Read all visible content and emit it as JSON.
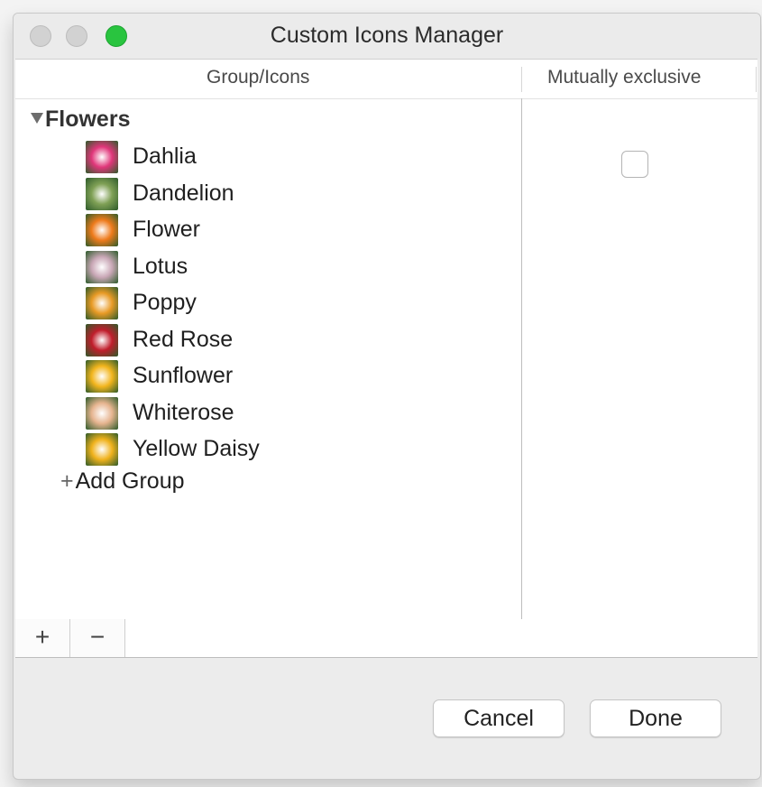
{
  "window": {
    "title": "Custom Icons Manager"
  },
  "table": {
    "columns": {
      "group_icons": "Group/Icons",
      "mutually_exclusive": "Mutually exclusive"
    },
    "group": {
      "name": "Flowers",
      "mutually_exclusive": false,
      "items": [
        {
          "label": "Dahlia",
          "icon": "dahlia-icon",
          "color": "#e0367a"
        },
        {
          "label": "Dandelion",
          "icon": "dandelion-icon",
          "color": "#7fa055"
        },
        {
          "label": "Flower",
          "icon": "flower-icon",
          "color": "#ee7a1b"
        },
        {
          "label": "Lotus",
          "icon": "lotus-icon",
          "color": "#c9a7b6"
        },
        {
          "label": "Poppy",
          "icon": "poppy-icon",
          "color": "#e89a25"
        },
        {
          "label": "Red Rose",
          "icon": "red-rose-icon",
          "color": "#c01d2b"
        },
        {
          "label": "Sunflower",
          "icon": "sunflower-icon",
          "color": "#f2b51d"
        },
        {
          "label": "Whiterose",
          "icon": "whiterose-icon",
          "color": "#e6b48f"
        },
        {
          "label": "Yellow Daisy",
          "icon": "yellow-daisy-icon",
          "color": "#f0b21c"
        }
      ]
    },
    "add_group_label": "Add Group"
  },
  "toolbar": {
    "add_symbol": "+",
    "remove_symbol": "−"
  },
  "buttons": {
    "cancel": "Cancel",
    "done": "Done"
  }
}
